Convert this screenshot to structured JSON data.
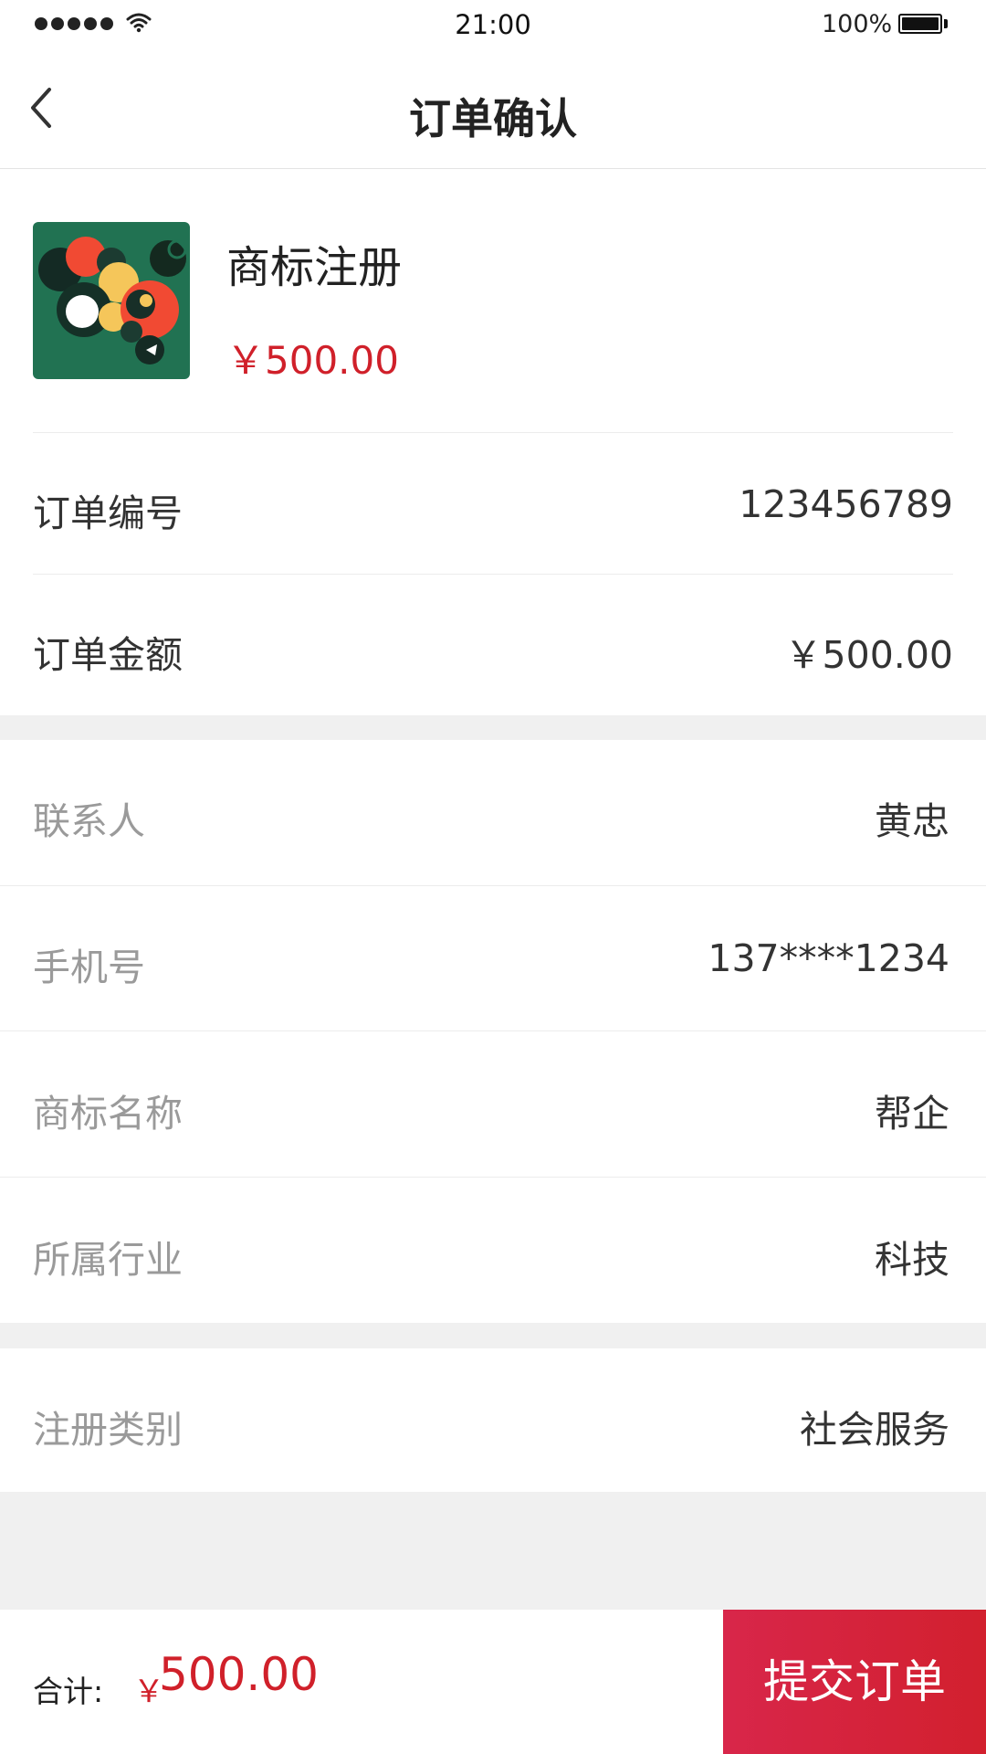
{
  "status_bar": {
    "time": "21:00",
    "battery": "100%"
  },
  "nav": {
    "back_icon": "chevron-left-icon",
    "title": "订单确认"
  },
  "product": {
    "name": "商标注册",
    "price": "￥500.00"
  },
  "order": {
    "rows": [
      {
        "label": "订单编号",
        "value": "123456789"
      },
      {
        "label": "订单金额",
        "value": "￥500.00"
      }
    ]
  },
  "contact": {
    "rows": [
      {
        "label": "联系人",
        "value": "黄忠"
      },
      {
        "label": "手机号",
        "value": "137****1234"
      },
      {
        "label": "商标名称",
        "value": "帮企"
      },
      {
        "label": "所属行业",
        "value": "科技"
      }
    ]
  },
  "category": {
    "label": "注册类别",
    "value": "社会服务"
  },
  "bottom_bar": {
    "total_label": "合计:",
    "currency": "￥",
    "total_amount": "500.00",
    "submit_label": "提交订单"
  },
  "colors": {
    "accent_red": "#d0202a",
    "background_gray": "#f0f0f0",
    "thumbnail_green": "#217252"
  }
}
